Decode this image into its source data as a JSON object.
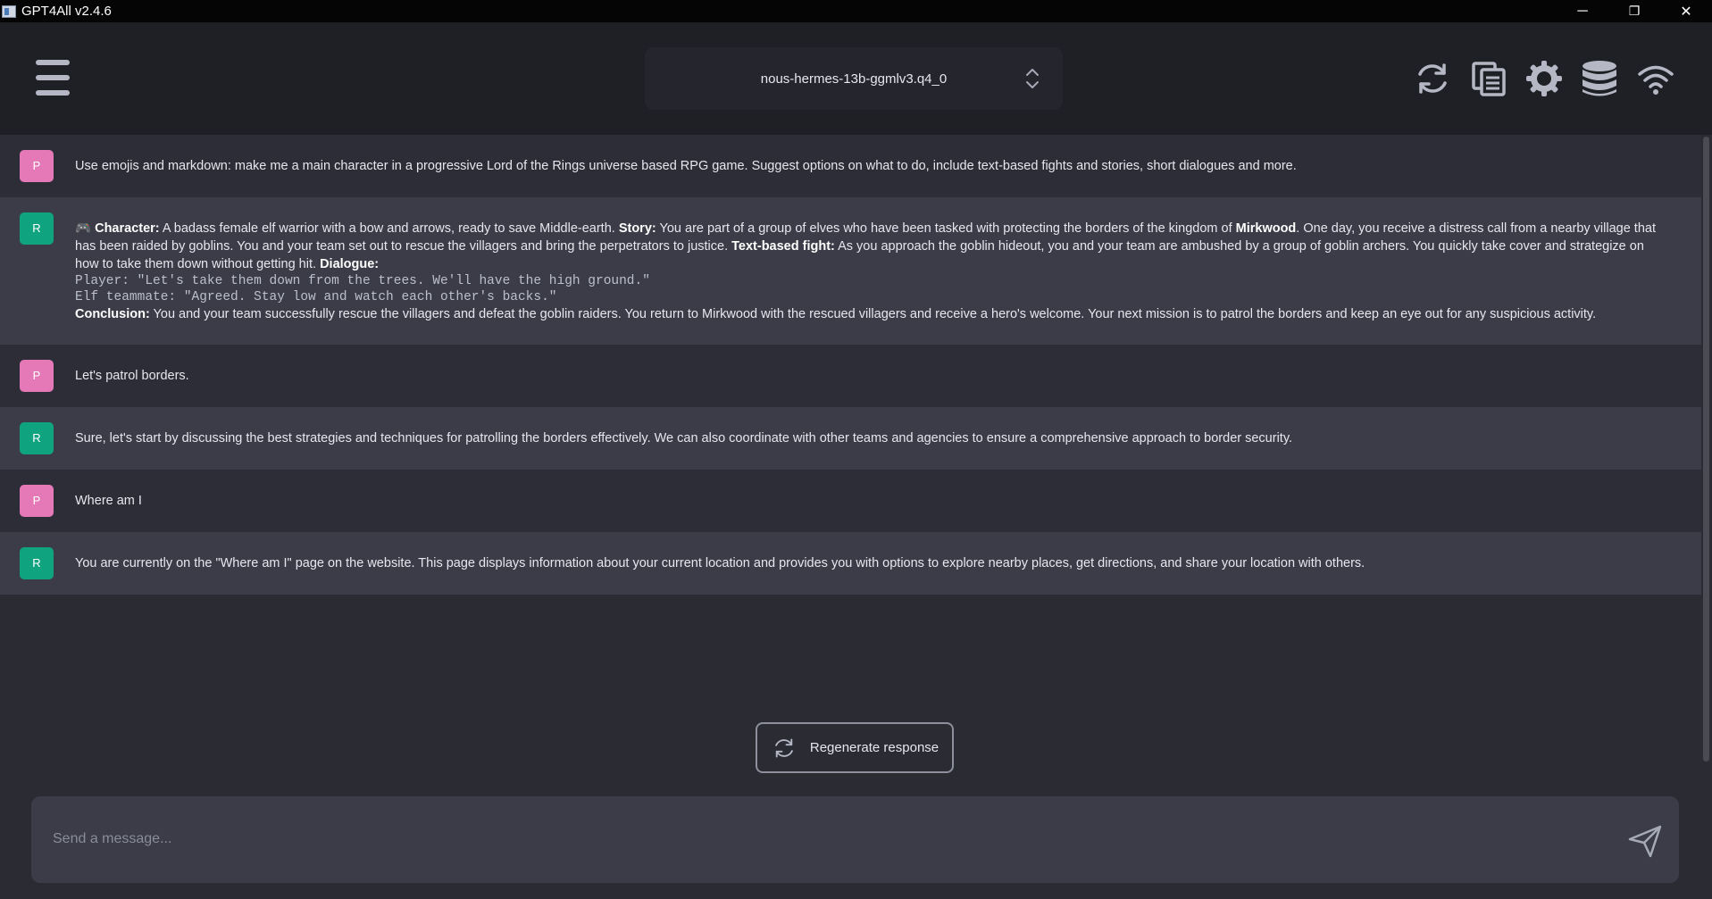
{
  "window": {
    "title": "GPT4All v2.4.6",
    "controls": {
      "minimize": "─",
      "restore": "❐",
      "close": "✕"
    }
  },
  "header": {
    "model_name": "nous-hermes-13b-ggmlv3.q4_0",
    "icons": [
      "menu-icon",
      "reset-icon",
      "copy-icon",
      "settings-icon",
      "database-icon",
      "wifi-icon"
    ]
  },
  "messages": [
    {
      "role": "prompt",
      "avatar": "P",
      "text": "Use emojis and markdown: make me a main character in a progressive Lord of the Rings universe based RPG game. Suggest options on what to do, include text-based fights and stories, short dialogues and more."
    },
    {
      "role": "response",
      "avatar": "R",
      "emoji": "🎮",
      "character_label": "Character:",
      "character_text": " A badass female elf warrior with a bow and arrows, ready to save Middle-earth. ",
      "story_label": "Story:",
      "story_text_1": " You are part of a group of elves who have been tasked with protecting the borders of the kingdom of ",
      "story_bold": "Mirkwood",
      "story_text_2": ". One day, you receive a distress call from a nearby village that has been raided by goblins. You and your team set out to rescue the villagers and bring the perpetrators to justice. ",
      "fight_label": "Text-based fight:",
      "fight_text": " As you approach the goblin hideout, you and your team are ambushed by a group of goblin archers. You quickly take cover and strategize on how to take them down without getting hit. ",
      "dialogue_label": "Dialogue:",
      "dialogue_line_1": "Player: \"Let's take them down from the trees. We'll have the high ground.\"",
      "dialogue_line_2": "Elf teammate: \"Agreed. Stay low and watch each other's backs.\"",
      "conclusion_label": "Conclusion:",
      "conclusion_text": " You and your team successfully rescue the villagers and defeat the goblin raiders. You return to Mirkwood with the rescued villagers and receive a hero's welcome. Your next mission is to patrol the borders and keep an eye out for any suspicious activity."
    },
    {
      "role": "prompt",
      "avatar": "P",
      "text": "Let's patrol borders."
    },
    {
      "role": "response",
      "avatar": "R",
      "text": "Sure, let's start by discussing the best strategies and techniques for patrolling the borders effectively. We can also coordinate with other teams and agencies to ensure a comprehensive approach to border security."
    },
    {
      "role": "prompt",
      "avatar": "P",
      "text": "Where am I"
    },
    {
      "role": "response",
      "avatar": "R",
      "text": "You are currently on the \"Where am I\" page on the website. This page displays information about your current location and provides you with options to explore nearby places, get directions, and share your location with others."
    }
  ],
  "regenerate_label": "Regenerate response",
  "composer": {
    "placeholder": "Send a message..."
  },
  "colors": {
    "background": "#2a2b33",
    "header": "#1f2026",
    "prompt_row": "#2c2d36",
    "response_row": "#3b3c47",
    "prompt_avatar": "#e579b8",
    "response_avatar": "#10a37f"
  }
}
